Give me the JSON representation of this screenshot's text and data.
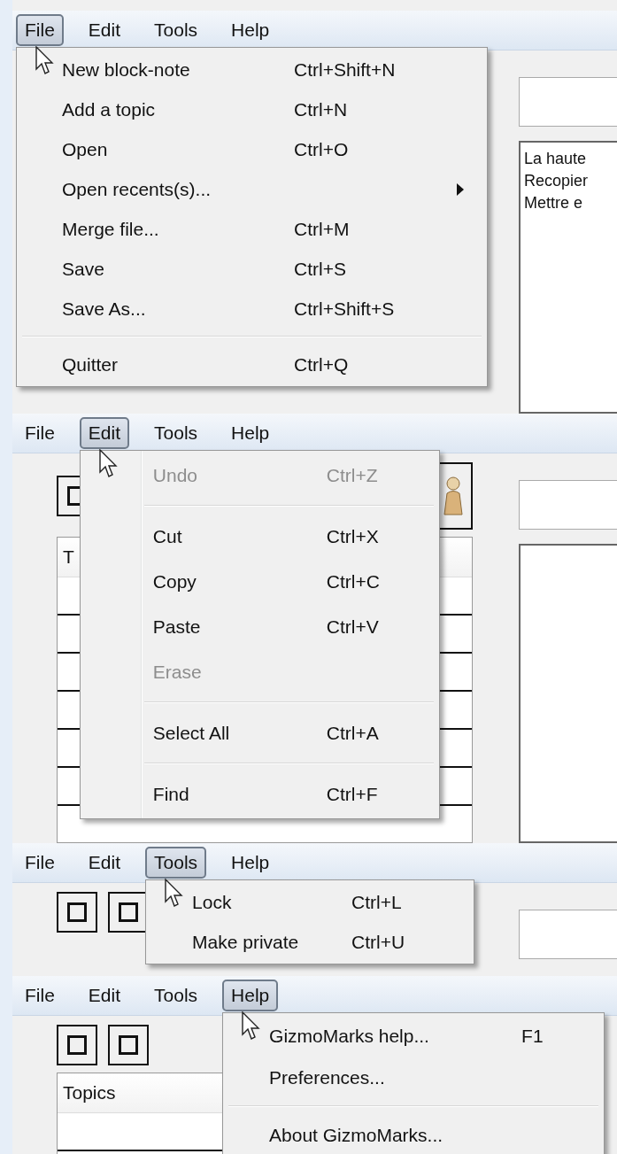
{
  "panels": [
    {
      "menubar": [
        {
          "label": "File",
          "selected": true
        },
        {
          "label": "Edit",
          "selected": false
        },
        {
          "label": "Tools",
          "selected": false
        },
        {
          "label": "Help",
          "selected": false
        }
      ],
      "menu": [
        {
          "kind": "command",
          "label": "New block-note",
          "shortcut": "Ctrl+Shift+N",
          "disabled": false
        },
        {
          "kind": "command",
          "label": "Add a topic",
          "shortcut": "Ctrl+N",
          "disabled": false
        },
        {
          "kind": "command",
          "label": "Open",
          "shortcut": "Ctrl+O",
          "disabled": false
        },
        {
          "kind": "submenu",
          "label": "Open recents(s)...",
          "disabled": false
        },
        {
          "kind": "command",
          "label": "Merge file...",
          "shortcut": "Ctrl+M",
          "disabled": false
        },
        {
          "kind": "command",
          "label": "Save",
          "shortcut": "Ctrl+S",
          "disabled": false
        },
        {
          "kind": "command",
          "label": "Save As...",
          "shortcut": "Ctrl+Shift+S",
          "disabled": false
        },
        {
          "kind": "separator"
        },
        {
          "kind": "command",
          "label": "Quitter",
          "shortcut": "Ctrl+Q",
          "disabled": false
        }
      ],
      "right": [
        {
          "kind": "text-field"
        },
        {
          "kind": "note",
          "lines": [
            "La haute",
            "Recopier",
            "Mettre e"
          ]
        }
      ]
    },
    {
      "menubar": [
        {
          "label": "File",
          "selected": false
        },
        {
          "label": "Edit",
          "selected": true
        },
        {
          "label": "Tools",
          "selected": false
        },
        {
          "label": "Help",
          "selected": false
        }
      ],
      "menu": [
        {
          "kind": "command",
          "label": "Undo",
          "shortcut": "Ctrl+Z",
          "disabled": true
        },
        {
          "kind": "separator"
        },
        {
          "kind": "command",
          "label": "Cut",
          "shortcut": "Ctrl+X",
          "disabled": false
        },
        {
          "kind": "command",
          "label": "Copy",
          "shortcut": "Ctrl+C",
          "disabled": false
        },
        {
          "kind": "command",
          "label": "Paste",
          "shortcut": "Ctrl+V",
          "disabled": false
        },
        {
          "kind": "command",
          "label": "Erase",
          "disabled": true
        },
        {
          "kind": "separator"
        },
        {
          "kind": "command",
          "label": "Select All",
          "shortcut": "Ctrl+A",
          "disabled": false
        },
        {
          "kind": "separator"
        },
        {
          "kind": "command",
          "label": "Find",
          "shortcut": "Ctrl+F",
          "disabled": false
        }
      ],
      "left": [
        {
          "kind": "full-toolbar"
        },
        {
          "kind": "list",
          "header": "T"
        }
      ],
      "right": [
        {
          "kind": "text-field"
        },
        {
          "kind": "note"
        }
      ]
    },
    {
      "menubar": [
        {
          "label": "File",
          "selected": false
        },
        {
          "label": "Edit",
          "selected": false
        },
        {
          "label": "Tools",
          "selected": true
        },
        {
          "label": "Help",
          "selected": false
        }
      ],
      "menu": [
        {
          "kind": "command",
          "label": "Lock",
          "shortcut": "Ctrl+L",
          "disabled": false
        },
        {
          "kind": "command",
          "label": "Make private",
          "shortcut": "Ctrl+U",
          "disabled": false
        }
      ],
      "left": [
        {
          "kind": "toolbar"
        }
      ],
      "right": [
        {
          "kind": "text-field"
        }
      ]
    },
    {
      "menubar": [
        {
          "label": "File",
          "selected": false
        },
        {
          "label": "Edit",
          "selected": false
        },
        {
          "label": "Tools",
          "selected": false
        },
        {
          "label": "Help",
          "selected": true
        }
      ],
      "menu": [
        {
          "kind": "command",
          "label": "GizmoMarks help...",
          "shortcut": "F1",
          "disabled": false
        },
        {
          "kind": "command",
          "label": "Preferences...",
          "disabled": false
        },
        {
          "kind": "separator"
        },
        {
          "kind": "command",
          "label": "About GizmoMarks...",
          "disabled": false
        }
      ],
      "left": [
        {
          "kind": "toolbar"
        },
        {
          "kind": "list",
          "header": "Topics"
        }
      ]
    }
  ]
}
